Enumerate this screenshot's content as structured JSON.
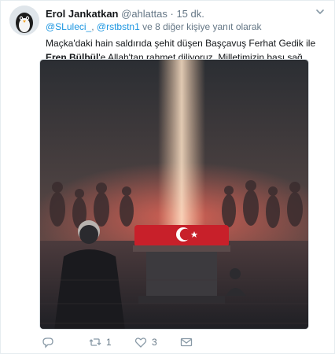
{
  "tweet": {
    "author_name": "Erol Jankatkan",
    "author_handle": "@ahlattas",
    "separator": "·",
    "time": "15 dk.",
    "reply_to": {
      "user": "@SLuleci_",
      "other": "@rstbstn1",
      "suffix": "ve 8 diğer kişiye yanıt olarak"
    },
    "text": {
      "before_bold": "Maçka'daki hain saldırıda şehit düşen Başçavuş Ferhat Gedik ile ",
      "bold": "Eren Bülbül",
      "after_bold": "'e Allah'tan rahmet diliyoruz. Milletimizin başı sağ olsun.."
    },
    "actions": {
      "reply_icon": "reply-icon",
      "retweet_icon": "retweet-icon",
      "retweet_count": "1",
      "like_icon": "heart-icon",
      "like_count": "3",
      "dm_icon": "direct-message-icon"
    }
  }
}
